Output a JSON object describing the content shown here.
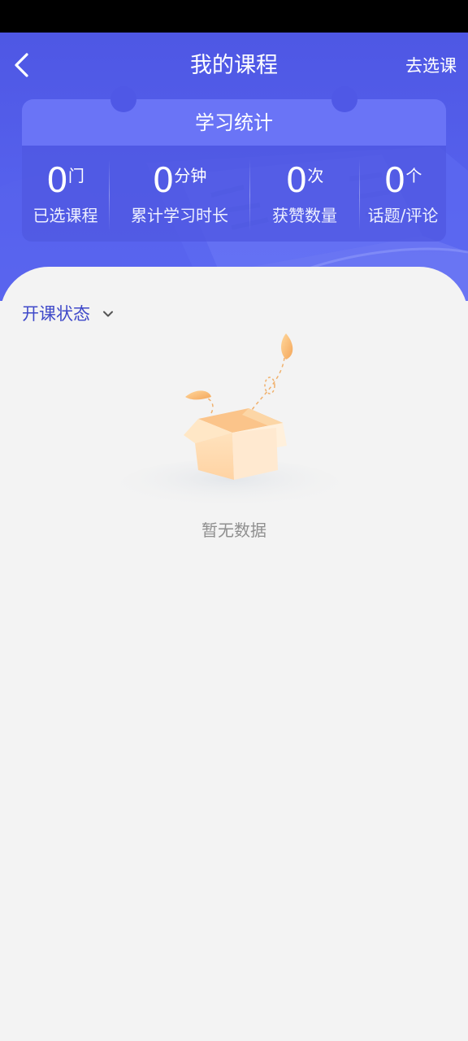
{
  "header": {
    "title": "我的课程",
    "action_label": "去选课",
    "back_icon": "chevron-left-icon"
  },
  "stats": {
    "title": "学习统计",
    "items": [
      {
        "value": "0",
        "unit": "门",
        "label": "已选课程"
      },
      {
        "value": "0",
        "unit": "分钟",
        "label": "累计学习时长"
      },
      {
        "value": "0",
        "unit": "次",
        "label": "获赞数量"
      },
      {
        "value": "0",
        "unit": "个",
        "label": "话题/评论"
      }
    ]
  },
  "filter": {
    "label": "开课状态",
    "icon": "chevron-down-icon"
  },
  "empty_state": {
    "text": "暂无数据",
    "icon": "empty-box-icon"
  },
  "colors": {
    "header_bg": "#4e57e4",
    "accent": "#3f49c9",
    "page_bg": "#f3f3f3"
  }
}
